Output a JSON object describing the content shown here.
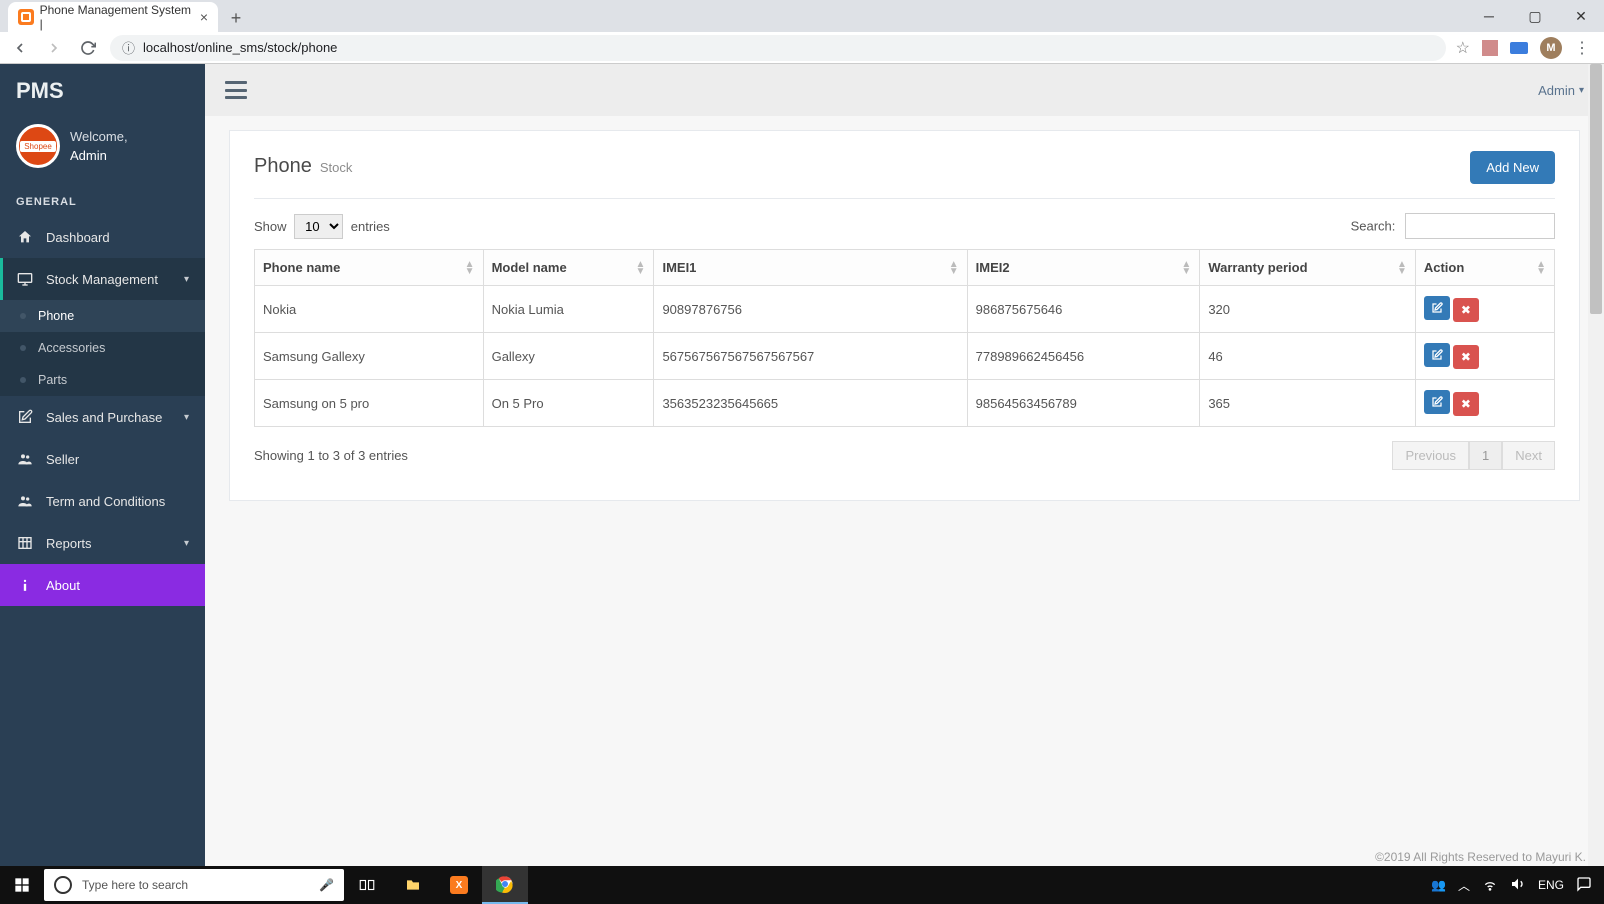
{
  "browser": {
    "tab_title": "Phone Management System |",
    "url": "localhost/online_sms/stock/phone",
    "avatar_letter": "M"
  },
  "sidebar": {
    "brand": "PMS",
    "welcome": "Welcome,",
    "username": "Admin",
    "section": "GENERAL",
    "items": {
      "dashboard": "Dashboard",
      "stock": "Stock Management",
      "phone": "Phone",
      "accessories": "Accessories",
      "parts": "Parts",
      "sales": "Sales and Purchase",
      "seller": "Seller",
      "terms": "Term and Conditions",
      "reports": "Reports",
      "about": "About"
    }
  },
  "topbar": {
    "user": "Admin"
  },
  "panel": {
    "title": "Phone",
    "subtitle": "Stock",
    "add_button": "Add New",
    "show_prefix": "Show",
    "show_suffix": "entries",
    "page_size": "10",
    "search_label": "Search:",
    "columns": {
      "phone_name": "Phone name",
      "model_name": "Model name",
      "imei1": "IMEI1",
      "imei2": "IMEI2",
      "warranty": "Warranty period",
      "action": "Action"
    },
    "rows": [
      {
        "phone_name": "Nokia",
        "model_name": "Nokia Lumia",
        "imei1": "90897876756",
        "imei2": "986875675646",
        "warranty": "320"
      },
      {
        "phone_name": "Samsung Gallexy",
        "model_name": "Gallexy",
        "imei1": "567567567567567567567",
        "imei2": "778989662456456",
        "warranty": "46"
      },
      {
        "phone_name": "Samsung on 5 pro",
        "model_name": "On 5 Pro",
        "imei1": "3563523235645665",
        "imei2": "98564563456789",
        "warranty": "365"
      }
    ],
    "info": "Showing 1 to 3 of 3 entries",
    "prev": "Previous",
    "page": "1",
    "next": "Next"
  },
  "footer": {
    "copyright": "©2019 All Rights Reserved to Mayuri K."
  },
  "taskbar": {
    "search_placeholder": "Type here to search",
    "lang": "ENG"
  }
}
